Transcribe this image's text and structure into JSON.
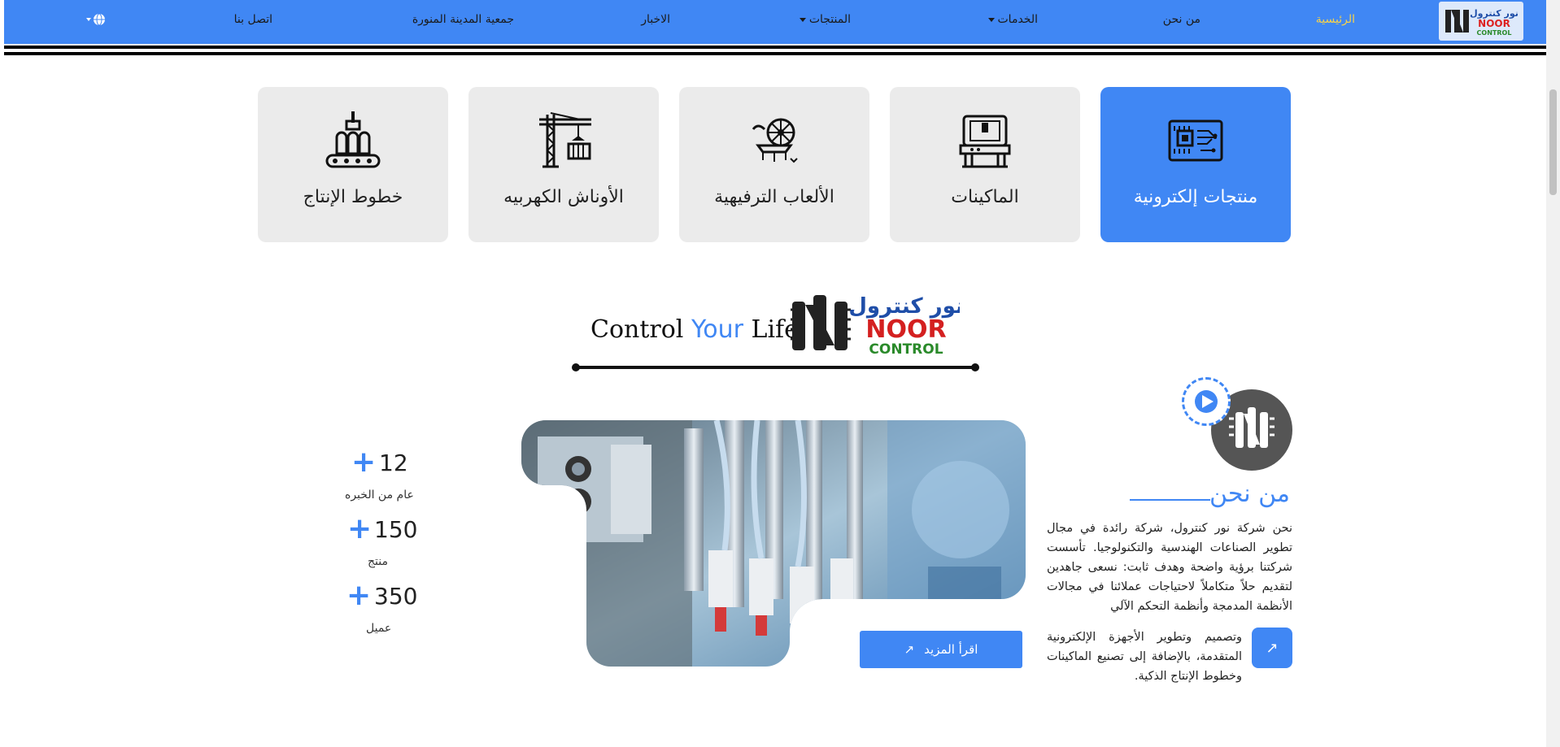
{
  "nav": {
    "items": [
      {
        "label": "الرئيسية",
        "active": true
      },
      {
        "label": "من نحن"
      },
      {
        "label": "الخدمات",
        "dropdown": true
      },
      {
        "label": "المنتجات",
        "dropdown": true
      },
      {
        "label": "الاخبار"
      },
      {
        "label": "جمعية المدينة المنورة"
      },
      {
        "label": "اتصل بنا"
      }
    ],
    "language_icon": "globe-icon",
    "logo": {
      "arabic": "نور كنترول",
      "line1": "NOOR",
      "line2": "CONTROL"
    }
  },
  "categories": [
    {
      "label": "منتجات إلكترونية",
      "icon": "circuit-board-icon",
      "selected": true
    },
    {
      "label": "الماكينات",
      "icon": "machine-icon"
    },
    {
      "label": "الألعاب الترفيهية",
      "icon": "amusement-ride-icon"
    },
    {
      "label": "الأوناش الكهربيه",
      "icon": "crane-icon"
    },
    {
      "label": "خطوط الإنتاج",
      "icon": "production-line-icon"
    }
  ],
  "brand": {
    "tagline_part1": "Control ",
    "tagline_part2": "Your",
    "tagline_part3": " Life",
    "logo_arabic": "نور كنترول",
    "logo_line1": "NOOR",
    "logo_line2": "CONTROL"
  },
  "stats": [
    {
      "value": "12",
      "plus": "+",
      "label": "عام من الخبره"
    },
    {
      "value": "150",
      "plus": "+",
      "label": "منتج"
    },
    {
      "value": "350",
      "plus": "+",
      "label": "عميل"
    }
  ],
  "about": {
    "title": "من نحن",
    "paragraph1": "نحن شركة نور كنترول، شركة رائدة في مجال تطوير الصناعات الهندسية والتكنولوجيا. تأسست شركتنا برؤية واضحة وهدف ثابت: نسعى جاهدين لتقديم حلاً متكاملاً لاحتياجات عملائنا في مجالات الأنظمة المدمجة وأنظمة التحكم الآلي",
    "paragraph2": "وتصميم وتطوير الأجهزة الإلكترونية المتقدمة، بالإضافة إلى تصنيع الماكينات وخطوط الإنتاج الذكية.",
    "read_more": "اقرأ المزيد",
    "arrow": "↗"
  },
  "colors": {
    "accent": "#4087f4",
    "active_nav": "#f7d24a",
    "card_bg": "#ebebeb"
  }
}
